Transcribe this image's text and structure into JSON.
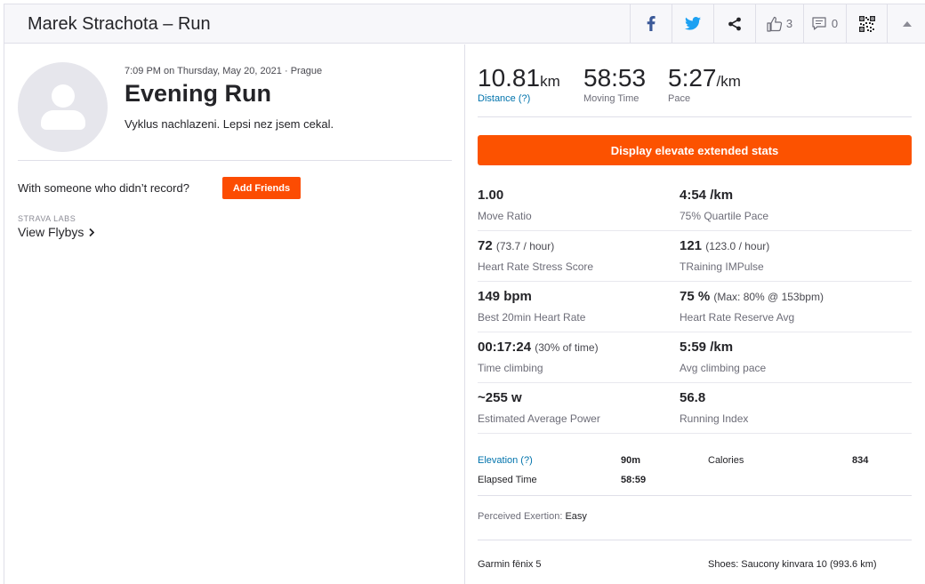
{
  "header": {
    "title": "Marek Strachota – Run",
    "kudos_count": "3",
    "comment_count": "0"
  },
  "activity": {
    "date": "7:09 PM on Thursday, May 20, 2021 · Prague",
    "name": "Evening Run",
    "description": "Vyklus nachlazeni. Lepsi nez jsem cekal.",
    "with_someone_text": "With someone who didn’t record?",
    "add_friends_label": "Add Friends",
    "labs_label": "STRAVA LABS",
    "flybys_label": "View Flybys"
  },
  "top_stats": [
    {
      "value": "10.81",
      "unit": "km",
      "label": "Distance (?)"
    },
    {
      "value": "58:53",
      "unit": "",
      "label": "Moving Time"
    },
    {
      "value": "5:27",
      "unit": "/km",
      "label": "Pace"
    }
  ],
  "extended_button_label": "Display elevate extended stats",
  "extended_stats": [
    [
      {
        "value": "1.00",
        "sub": "",
        "label": "Move Ratio"
      },
      {
        "value": "4:54 /km",
        "sub": "",
        "label": "75% Quartile Pace"
      }
    ],
    [
      {
        "value": "72",
        "sub": "(73.7 / hour)",
        "label": "Heart Rate Stress Score"
      },
      {
        "value": "121",
        "sub": "(123.0 / hour)",
        "label": "TRaining IMPulse"
      }
    ],
    [
      {
        "value": "149 bpm",
        "sub": "",
        "label": "Best 20min Heart Rate"
      },
      {
        "value": "75 %",
        "sub": "(Max: 80% @ 153bpm)",
        "label": "Heart Rate Reserve Avg"
      }
    ],
    [
      {
        "value": "00:17:24",
        "sub": "(30% of time)",
        "label": "Time climbing"
      },
      {
        "value": "5:59 /km",
        "sub": "",
        "label": "Avg climbing pace"
      }
    ],
    [
      {
        "value": "~255 w",
        "sub": "",
        "label": "Estimated Average Power"
      },
      {
        "value": "56.8",
        "sub": "",
        "label": "Running Index"
      }
    ]
  ],
  "more_stats": {
    "elevation_label": "Elevation (?)",
    "elevation_value": "90m",
    "calories_label": "Calories",
    "calories_value": "834",
    "elapsed_label": "Elapsed Time",
    "elapsed_value": "58:59"
  },
  "perceived_label": "Perceived Exertion:",
  "perceived_value": "Easy",
  "device": "Garmin fēnix 5",
  "shoes": "Shoes: Saucony kinvara 10 (993.6 km)",
  "colors": {
    "accent": "#fc5200",
    "link": "#0073ac",
    "facebook": "#3b5998",
    "twitter": "#1da1f2"
  }
}
